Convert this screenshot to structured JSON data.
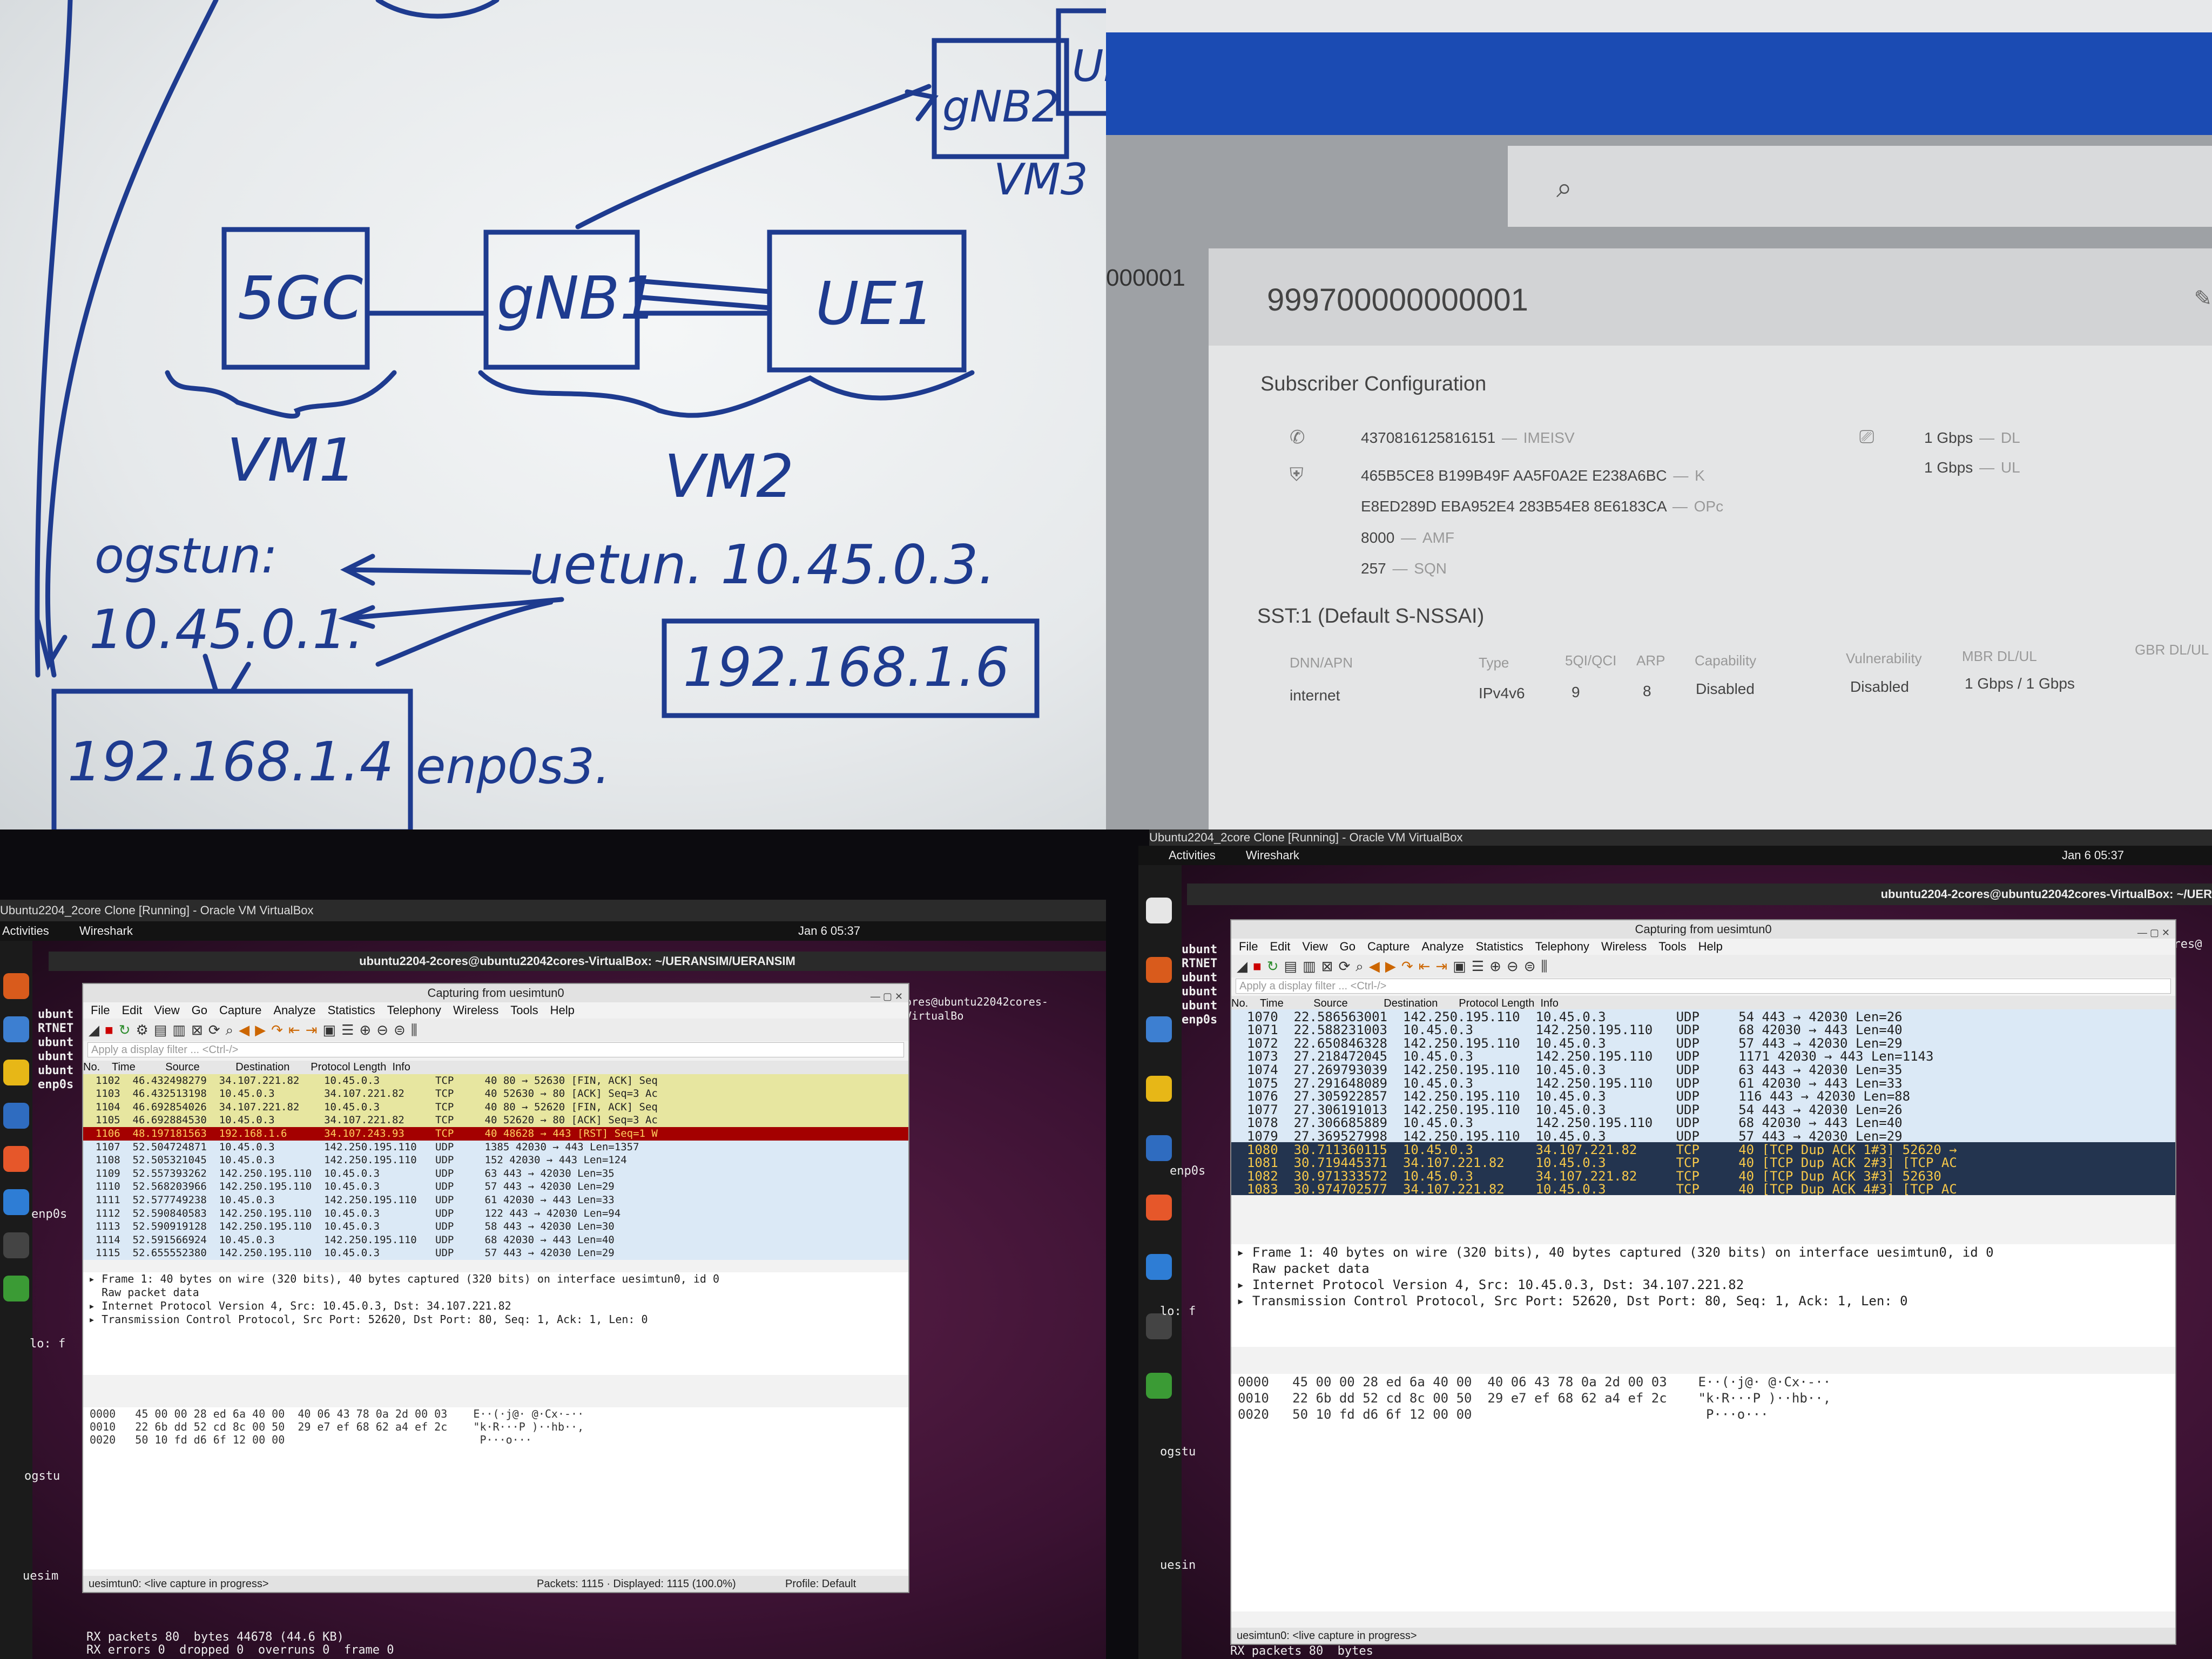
{
  "whiteboard": {
    "boxes": {
      "core": "5GC",
      "gnb1": "gNB1",
      "ue1": "UE1",
      "gnb2": "gNB2",
      "ue2": "UE"
    },
    "vm_labels": {
      "vm1": "VM1",
      "vm2": "VM2",
      "vm3": "VM3"
    },
    "ogstun_label": "ogstun:",
    "uertun_label": "uetun. 10.45.0.3.",
    "ogstun_ip": "10.45.0.1.",
    "ip_vm2": "192.168.1.6",
    "ip_vm1": "192.168.1.4",
    "iface": "enp0s3."
  },
  "webui": {
    "left_partial_id": "000001",
    "imsi": "999700000000001",
    "section_title": "Subscriber Configuration",
    "imeisv_value": "4370816125816151",
    "imeisv_label": "IMEISV",
    "k_value": "465B5CE8 B199B49F AA5F0A2E E238A6BC",
    "k_label": "K",
    "opc_value": "E8ED289D EBA952E4 283B54E8 8E6183CA",
    "opc_label": "OPc",
    "amf_value": "8000",
    "amf_label": "AMF",
    "sqn_value": "257",
    "sqn_label": "SQN",
    "dl_value": "1 Gbps",
    "dl_label": "DL",
    "ul_value": "1 Gbps",
    "ul_label": "UL",
    "slice_title": "SST:1 (Default S-NSSAI)",
    "table_headers": [
      "DNN/APN",
      "Type",
      "5QI/QCI",
      "ARP",
      "Capability",
      "Vulnerability",
      "MBR DL/UL",
      "GBR DL/UL"
    ],
    "table_row": [
      "internet",
      "IPv4v6",
      "9",
      "8",
      "Disabled",
      "Disabled",
      "1 Gbps / 1 Gbps",
      ""
    ],
    "icons": {
      "search": "search-icon",
      "phone": "phone-icon",
      "shield": "shield-icon",
      "cast": "cast-icon",
      "edit": "edit-icon"
    }
  },
  "ws_left": {
    "vbox_title": "Ubuntu2204_2core Clone [Running] - Oracle VM VirtualBox",
    "activities": "Activities",
    "app": "Wireshark",
    "clock": "Jan 6 05:37",
    "terminal_title": "ubuntu2204-2cores@ubuntu22042cores-VirtualBox: ~/UERANSIM/UERANSIM",
    "terminal_right": "ores@ubuntu22042cores-VirtualBo",
    "window_title": "Capturing from uesimtun0",
    "menu": [
      "File",
      "Edit",
      "View",
      "Go",
      "Capture",
      "Analyze",
      "Statistics",
      "Telephony",
      "Wireless",
      "Tools",
      "Help"
    ],
    "filter_placeholder": "Apply a display filter ... <Ctrl-/>",
    "col_headers": [
      "No.",
      "Time",
      "Source",
      "Destination",
      "Protocol",
      "Length",
      "Info"
    ],
    "rows": [
      {
        "no": "1102",
        "time": "46.432498279",
        "src": "34.107.221.82",
        "dst": "10.45.0.3",
        "proto": "TCP",
        "info": "40 80 → 52630 [FIN, ACK] Seq",
        "kind": "tcp"
      },
      {
        "no": "1103",
        "time": "46.432513198",
        "src": "10.45.0.3",
        "dst": "34.107.221.82",
        "proto": "TCP",
        "info": "40 52630 → 80 [ACK] Seq=3 Ac",
        "kind": "tcp"
      },
      {
        "no": "1104",
        "time": "46.692854026",
        "src": "34.107.221.82",
        "dst": "10.45.0.3",
        "proto": "TCP",
        "info": "40 80 → 52620 [FIN, ACK] Seq",
        "kind": "tcp"
      },
      {
        "no": "1105",
        "time": "46.692884530",
        "src": "10.45.0.3",
        "dst": "34.107.221.82",
        "proto": "TCP",
        "info": "40 52620 → 80 [ACK] Seq=3 Ac",
        "kind": "tcp"
      },
      {
        "no": "1106",
        "time": "48.197181563",
        "src": "192.168.1.6",
        "dst": "34.107.243.93",
        "proto": "TCP",
        "info": "40 48628 → 443 [RST] Seq=1 W",
        "kind": "rst"
      },
      {
        "no": "1107",
        "time": "52.504724871",
        "src": "10.45.0.3",
        "dst": "142.250.195.110",
        "proto": "UDP",
        "info": "1385 42030 → 443 Len=1357",
        "kind": "udp"
      },
      {
        "no": "1108",
        "time": "52.505321045",
        "src": "10.45.0.3",
        "dst": "142.250.195.110",
        "proto": "UDP",
        "info": "152 42030 → 443 Len=124",
        "kind": "udp"
      },
      {
        "no": "1109",
        "time": "52.557393262",
        "src": "142.250.195.110",
        "dst": "10.45.0.3",
        "proto": "UDP",
        "info": "63 443 → 42030 Len=35",
        "kind": "udp"
      },
      {
        "no": "1110",
        "time": "52.568203966",
        "src": "142.250.195.110",
        "dst": "10.45.0.3",
        "proto": "UDP",
        "info": "57 443 → 42030 Len=29",
        "kind": "udp"
      },
      {
        "no": "1111",
        "time": "52.577749238",
        "src": "10.45.0.3",
        "dst": "142.250.195.110",
        "proto": "UDP",
        "info": "61 42030 → 443 Len=33",
        "kind": "udp"
      },
      {
        "no": "1112",
        "time": "52.590840583",
        "src": "142.250.195.110",
        "dst": "10.45.0.3",
        "proto": "UDP",
        "info": "122 443 → 42030 Len=94",
        "kind": "udp"
      },
      {
        "no": "1113",
        "time": "52.590919128",
        "src": "142.250.195.110",
        "dst": "10.45.0.3",
        "proto": "UDP",
        "info": "58 443 → 42030 Len=30",
        "kind": "udp"
      },
      {
        "no": "1114",
        "time": "52.591566924",
        "src": "10.45.0.3",
        "dst": "142.250.195.110",
        "proto": "UDP",
        "info": "68 42030 → 443 Len=40",
        "kind": "udp"
      },
      {
        "no": "1115",
        "time": "52.655552380",
        "src": "142.250.195.110",
        "dst": "10.45.0.3",
        "proto": "UDP",
        "info": "57 443 → 42030 Len=29",
        "kind": "udp"
      }
    ],
    "details": [
      "▸ Frame 1: 40 bytes on wire (320 bits), 40 bytes captured (320 bits) on interface uesimtun0, id 0",
      "  Raw packet data",
      "▸ Internet Protocol Version 4, Src: 10.45.0.3, Dst: 34.107.221.82",
      "▸ Transmission Control Protocol, Src Port: 52620, Dst Port: 80, Seq: 1, Ack: 1, Len: 0"
    ],
    "hex": [
      "0000   45 00 00 28 ed 6a 40 00  40 06 43 78 0a 2d 00 03    E··(·j@· @·Cx·-··",
      "0010   22 6b dd 52 cd 8c 00 50  29 e7 ef 68 62 a4 ef 2c    \"k·R···P )··hb··,",
      "0020   50 10 fd d6 6f 12 00 00                              P···o···"
    ],
    "status": "uesimtun0: <live capture in progress>",
    "packets": "Packets: 1115 · Displayed: 1115 (100.0%)",
    "profile": "Profile: Default",
    "side_text": [
      "ubunt",
      "RTNET",
      "ubunt",
      "ubunt",
      "ubunt",
      "enp0s"
    ],
    "side_labels": [
      "enp0s",
      "lo: f",
      "ogstu",
      "uesim"
    ],
    "bottom_lines": [
      "RX packets 80  bytes 44678 (44.6 KB)",
      "RX errors 0  dropped 0  overruns 0  frame 0"
    ]
  },
  "ws_right": {
    "vbox_title": "Ubuntu2204_2core Clone [Running] - Oracle VM VirtualBox",
    "activities": "Activities",
    "app": "Wireshark",
    "clock": "Jan 6 05:37",
    "terminal_title": "ubuntu2204-2cores@ubuntu22042cores-VirtualBox: ~/UER",
    "terminal_right": "cores@",
    "window_title": "Capturing from uesimtun0",
    "menu": [
      "File",
      "Edit",
      "View",
      "Go",
      "Capture",
      "Analyze",
      "Statistics",
      "Telephony",
      "Wireless",
      "Tools",
      "Help"
    ],
    "filter_placeholder": "Apply a display filter ... <Ctrl-/>",
    "col_headers": [
      "No.",
      "Time",
      "Source",
      "Destination",
      "Protocol",
      "Length",
      "Info"
    ],
    "rows": [
      {
        "no": "1070",
        "time": "22.586563001",
        "src": "142.250.195.110",
        "dst": "10.45.0.3",
        "proto": "UDP",
        "info": "54 443 → 42030 Len=26",
        "kind": "udp"
      },
      {
        "no": "1071",
        "time": "22.588231003",
        "src": "10.45.0.3",
        "dst": "142.250.195.110",
        "proto": "UDP",
        "info": "68 42030 → 443 Len=40",
        "kind": "udp"
      },
      {
        "no": "1072",
        "time": "22.650846328",
        "src": "142.250.195.110",
        "dst": "10.45.0.3",
        "proto": "UDP",
        "info": "57 443 → 42030 Len=29",
        "kind": "udp"
      },
      {
        "no": "1073",
        "time": "27.218472045",
        "src": "10.45.0.3",
        "dst": "142.250.195.110",
        "proto": "UDP",
        "info": "1171 42030 → 443 Len=1143",
        "kind": "udp"
      },
      {
        "no": "1074",
        "time": "27.269793039",
        "src": "142.250.195.110",
        "dst": "10.45.0.3",
        "proto": "UDP",
        "info": "63 443 → 42030 Len=35",
        "kind": "udp"
      },
      {
        "no": "1075",
        "time": "27.291648089",
        "src": "10.45.0.3",
        "dst": "142.250.195.110",
        "proto": "UDP",
        "info": "61 42030 → 443 Len=33",
        "kind": "udp"
      },
      {
        "no": "1076",
        "time": "27.305922857",
        "src": "142.250.195.110",
        "dst": "10.45.0.3",
        "proto": "UDP",
        "info": "116 443 → 42030 Len=88",
        "kind": "udp"
      },
      {
        "no": "1077",
        "time": "27.306191013",
        "src": "142.250.195.110",
        "dst": "10.45.0.3",
        "proto": "UDP",
        "info": "54 443 → 42030 Len=26",
        "kind": "udp"
      },
      {
        "no": "1078",
        "time": "27.306685889",
        "src": "10.45.0.3",
        "dst": "142.250.195.110",
        "proto": "UDP",
        "info": "68 42030 → 443 Len=40",
        "kind": "udp"
      },
      {
        "no": "1079",
        "time": "27.369527998",
        "src": "142.250.195.110",
        "dst": "10.45.0.3",
        "proto": "UDP",
        "info": "57 443 → 42030 Len=29",
        "kind": "udp"
      },
      {
        "no": "1080",
        "time": "30.711360115",
        "src": "10.45.0.3",
        "dst": "34.107.221.82",
        "proto": "TCP",
        "info": "40 [TCP Dup ACK 1#3] 52620 →",
        "kind": "dark"
      },
      {
        "no": "1081",
        "time": "30.719445371",
        "src": "34.107.221.82",
        "dst": "10.45.0.3",
        "proto": "TCP",
        "info": "40 [TCP Dup ACK 2#3] [TCP AC",
        "kind": "dark"
      },
      {
        "no": "1082",
        "time": "30.971333572",
        "src": "10.45.0.3",
        "dst": "34.107.221.82",
        "proto": "TCP",
        "info": "40 [TCP Dup ACK 3#3] 52630",
        "kind": "dark"
      },
      {
        "no": "1083",
        "time": "30.974702577",
        "src": "34.107.221.82",
        "dst": "10.45.0.3",
        "proto": "TCP",
        "info": "40 [TCP Dup ACK 4#3] [TCP AC",
        "kind": "dark"
      }
    ],
    "details": [
      "▸ Frame 1: 40 bytes on wire (320 bits), 40 bytes captured (320 bits) on interface uesimtun0, id 0",
      "  Raw packet data",
      "▸ Internet Protocol Version 4, Src: 10.45.0.3, Dst: 34.107.221.82",
      "▸ Transmission Control Protocol, Src Port: 52620, Dst Port: 80, Seq: 1, Ack: 1, Len: 0"
    ],
    "hex": [
      "0000   45 00 00 28 ed 6a 40 00  40 06 43 78 0a 2d 00 03    E··(·j@· @·Cx·-··",
      "0010   22 6b dd 52 cd 8c 00 50  29 e7 ef 68 62 a4 ef 2c    \"k·R···P )··hb··,",
      "0020   50 10 fd d6 6f 12 00 00                              P···o···"
    ],
    "status": "uesimtun0: <live capture in progress>",
    "side_text": [
      "ubunt",
      "RTNET",
      "ubunt",
      "ubunt",
      "ubunt",
      "enp0s"
    ],
    "side_labels": [
      "enp0s",
      "lo: f",
      "ogstu",
      "uesin"
    ],
    "bottom_lines": [
      "RX packets 80  bytes"
    ]
  }
}
